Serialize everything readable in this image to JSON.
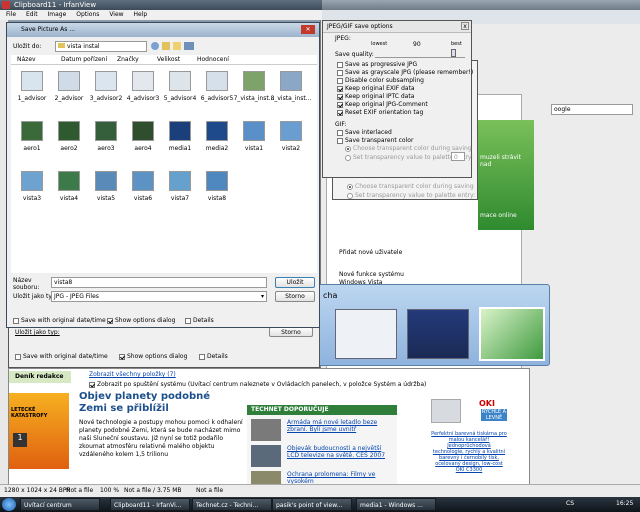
{
  "main_window": {
    "title": "Clipboard11 - IrfanView",
    "menu": [
      "File",
      "Edit",
      "Image",
      "Options",
      "View",
      "Help"
    ],
    "status": {
      "dimensions": "1280 x 1024 x 24 BPP",
      "file": "Not a file",
      "zoom": "100 %",
      "size": "Not a file / 3.75 MB",
      "file2": "Not a file"
    }
  },
  "save_dialog": {
    "title": "Save Picture As ...",
    "save_in_label": "Uložit do:",
    "folder": "vista instal",
    "columns": [
      "Název",
      "Datum pořízení",
      "Značky",
      "Velikost",
      "Hodnocení"
    ],
    "files": [
      {
        "name": "1_advisor",
        "color": "#d8e4ee"
      },
      {
        "name": "2_advisor",
        "color": "#cfdce8"
      },
      {
        "name": "3_advisor2",
        "color": "#dbe5ef"
      },
      {
        "name": "4_advisor3",
        "color": "#e2e8ee"
      },
      {
        "name": "5_advisor4",
        "color": "#dde4ea"
      },
      {
        "name": "6_advisor5",
        "color": "#d6e0ea"
      },
      {
        "name": "7_vista_inst...",
        "color": "#7da36a"
      },
      {
        "name": "8_vista_inst...",
        "color": "#8aa7c8"
      },
      {
        "name": "aero1",
        "color": "#3a6a3a"
      },
      {
        "name": "aero2",
        "color": "#2f5a2f"
      },
      {
        "name": "aero3",
        "color": "#355f3a"
      },
      {
        "name": "aero4",
        "color": "#2e4e2e"
      },
      {
        "name": "media1",
        "color": "#1a3f7a"
      },
      {
        "name": "media2",
        "color": "#1e4a8c"
      },
      {
        "name": "vista1",
        "color": "#5b8fc8"
      },
      {
        "name": "vista2",
        "color": "#6a9ed0"
      },
      {
        "name": "vista3",
        "color": "#6ea2d0"
      },
      {
        "name": "vista4",
        "color": "#3c7a4a"
      },
      {
        "name": "vista5",
        "color": "#5a8ab8"
      },
      {
        "name": "vista6",
        "color": "#5c92c4"
      },
      {
        "name": "vista7",
        "color": "#66a0cc"
      },
      {
        "name": "vista8",
        "color": "#4e88be"
      }
    ],
    "filename_label": "Název souboru:",
    "filename_value": "vista8",
    "filetype_label": "Uložit jako typ:",
    "filetype_value": "JPG - JPEG Files",
    "save_button": "Uložit",
    "cancel_button": "Storno",
    "opt_original_date": "Save with original date/time",
    "opt_show_options": "Show options dialog",
    "opt_details": "Details"
  },
  "jpeg_options": {
    "title": "JPEG/GIF save options",
    "jpeg_label": "JPEG:",
    "lowest": "lowest",
    "quality_value": "90",
    "best": "best",
    "save_quality": "Save quality:",
    "options": [
      {
        "label": "Save as progressive JPG",
        "checked": false
      },
      {
        "label": "Save as grayscale JPG (please remember!)",
        "checked": false
      },
      {
        "label": "Disable color subsampling",
        "checked": false
      },
      {
        "label": "Keep original EXIF data",
        "checked": true
      },
      {
        "label": "Keep original IPTC data",
        "checked": true
      },
      {
        "label": "Keep original JPG-Comment",
        "checked": true
      },
      {
        "label": "Reset EXIF orientation tag",
        "checked": true
      }
    ],
    "gif_label": "GIF:",
    "gif_interlaced": "Save interlaced",
    "gif_transparent": "Save transparent color",
    "radio_choose": "Choose transparent color during saving",
    "radio_set": "Set transparency value to palette entry:",
    "palette_value": "0",
    "close": "x"
  },
  "ghost_window": {
    "radio_choose": "Choose transparent color during saving",
    "radio_set": "Set transparency value to palette entry:",
    "palette_value": "0",
    "original_date": "Save with original date/time",
    "show_options": "Show options dialog",
    "details": "Details",
    "save_as": "Uložit jako typ:",
    "cancel": "Storno"
  },
  "background_page": {
    "welcome_items": [
      "Přidat nové uživatele",
      "Nové funkce systému Windows Vista"
    ],
    "vista_banner": [
      "muzeli strávit nad",
      "mace online"
    ],
    "search_hint": "oogle",
    "startup_checkbox": "Zobrazit po spuštění systému (Uvítací centrum naleznete v Ovládacích panelech, v položce Systém a údržba)",
    "show_all": "Zobrazit všechny položky (7)",
    "news_section": "Deník redakce",
    "headline": "Objev planety podobné Zemi se přiblížil",
    "article": "Nové technologie a postupy mohou pomoci k odhalení planety podobné Zemi, která se bude nacházet mimo naši Sluneční soustavu. Již nyní se totiž podařilo zkoumat atmosféru relativně malého objektu vzdáleného kolem 1,5 trilionu",
    "disaster_label": "LETECKÉ KATASTROFY",
    "tips_header": "TECHNET DOPORUČUJE",
    "tips": [
      "Armáda má nové letadlo beze zbraní. Bylí jsme uvnitř",
      "Objevák budoucnosti a největší LCD televize na světě. CES 2007",
      "Ochrana prolomena: Filmy ve vysokém"
    ],
    "ad_brand": "OKI",
    "ad_badge": "RYCHLE A LEVNĚ",
    "ad_text": "Perfektní barevná tiskárna pro malou kancelář! Jednoprůchodová technologie, rychlý a kvalitní barevný i černobílý tisk, ocelovaný design, low-cost OKI C3300"
  },
  "flip_label": "cha",
  "taskbar": {
    "items": [
      "Uvítací centrum",
      "Clipboard11 - IrfanVi...",
      "Technet.cz - Techni...",
      "pasik's point of view...",
      "media1 - Windows ..."
    ],
    "lang": "CS",
    "clock": "16:25"
  }
}
